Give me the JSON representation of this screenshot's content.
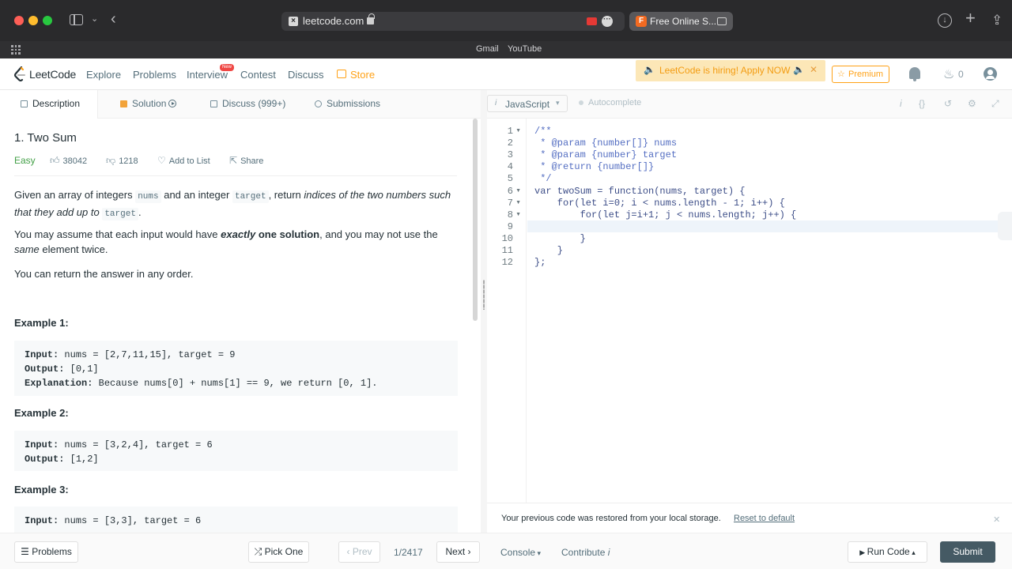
{
  "browser": {
    "url": "leetcode.com",
    "tab_title": "Free Online S...",
    "tab_favicon_letter": "F",
    "bookmarks": [
      "Gmail",
      "YouTube"
    ]
  },
  "nav": {
    "brand": "LeetCode",
    "links": [
      "Explore",
      "Problems",
      "Interview",
      "Contest",
      "Discuss",
      "Store"
    ],
    "new_badge": "New",
    "hiring": "LeetCode is hiring! Apply NOW",
    "premium": "Premium",
    "streak_count": "0"
  },
  "left_tabs": [
    "Description",
    "Solution",
    "Discuss (999+)",
    "Submissions"
  ],
  "problem": {
    "title": "1. Two Sum",
    "difficulty": "Easy",
    "likes": "38042",
    "dislikes": "1218",
    "add_to_list": "Add to List",
    "share": "Share",
    "p1_a": "Given an array of integers ",
    "p1_nums": "nums",
    "p1_b": " and an integer ",
    "p1_target": "target",
    "p1_c": ", return ",
    "p1_em": "indices of the two numbers such that they add up to",
    "p1_d": " ",
    "p1_target2": "target",
    "p1_e": ".",
    "p2_a": "You may assume that each input would have ",
    "p2_em": "exactly",
    "p2_b": " one solution",
    "p2_c": ", and you may not use the ",
    "p2_same": "same",
    "p2_d": " element twice.",
    "p3": "You can return the answer in any order."
  },
  "examples": [
    {
      "title": "Example 1:",
      "input_label": "Input:",
      "input": " nums = [2,7,11,15], target = 9",
      "output_label": "Output:",
      "output": " [0,1]",
      "explanation_label": "Explanation:",
      "explanation": " Because nums[0] + nums[1] == 9, we return [0, 1]."
    },
    {
      "title": "Example 2:",
      "input_label": "Input:",
      "input": " nums = [3,2,4], target = 6",
      "output_label": "Output:",
      "output": " [1,2]"
    },
    {
      "title": "Example 3:",
      "input_label": "Input:",
      "input": " nums = [3,3], target = 6"
    }
  ],
  "editor": {
    "language": "JavaScript",
    "autocomplete": "Autocomplete",
    "line_numbers": [
      "1",
      "2",
      "3",
      "4",
      "5",
      "6",
      "7",
      "8",
      "9",
      "10",
      "11",
      "12"
    ],
    "lines": [
      "/**",
      " * @param {number[]} nums",
      " * @param {number} target",
      " * @return {number[]}",
      " */",
      "var twoSum = function(nums, target) {",
      "    for(let i=0; i < nums.length - 1; i++) {",
      "        for(let j=i+1; j < nums.length; j++) {",
      "",
      "        }",
      "    }",
      "};"
    ],
    "restore_message": "Your previous code was restored from your local storage.",
    "reset_link": "Reset to default"
  },
  "bottom": {
    "problems": "Problems",
    "pick_one": "Pick One",
    "prev": "Prev",
    "page": "1/2417",
    "next": "Next",
    "console": "Console",
    "contribute": "Contribute",
    "run_code": "Run Code",
    "submit": "Submit"
  }
}
